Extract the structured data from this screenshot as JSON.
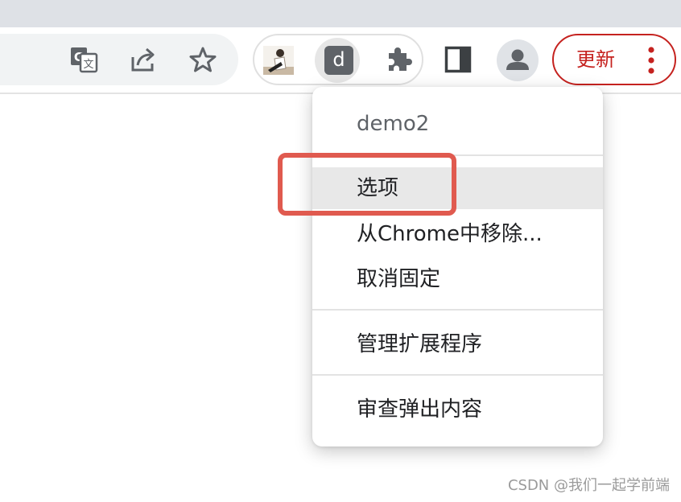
{
  "toolbar": {
    "icons": [
      "translate-icon",
      "share-icon",
      "bookmark-star-icon",
      "extension-thumbnail-icon",
      "extension-d-icon",
      "extensions-puzzle-icon",
      "side-panel-icon",
      "profile-avatar-icon",
      "more-vert-icon"
    ],
    "extension_d_letter": "d",
    "update_label": "更新",
    "update_color": "#c5221f"
  },
  "menu": {
    "title": "demo2",
    "items": [
      {
        "label": "选项",
        "highlighted": true
      },
      {
        "label": "从Chrome中移除..."
      },
      {
        "label": "取消固定"
      },
      {
        "label": "管理扩展程序"
      },
      {
        "label": "审查弹出内容"
      }
    ]
  },
  "annotation": {
    "highlight_color": "#e05a4f"
  },
  "watermark": "CSDN @我们一起学前端"
}
